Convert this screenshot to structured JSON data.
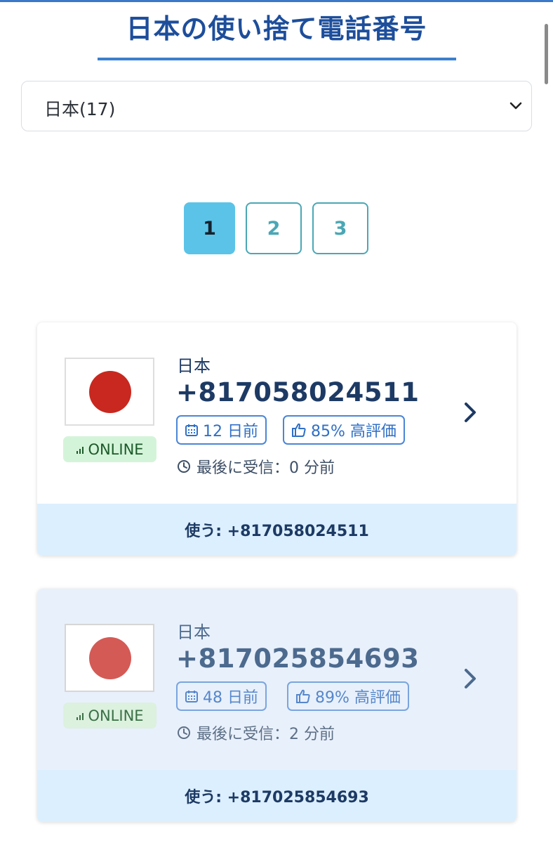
{
  "page": {
    "title": "日本の使い捨て電話番号"
  },
  "country_select": {
    "value": "日本(17)"
  },
  "pagination": {
    "pages": [
      "1",
      "2",
      "3"
    ],
    "active": "1"
  },
  "cards": [
    {
      "country": "日本",
      "number": "+817058024511",
      "status": "ONLINE",
      "age": "12 日前",
      "rating": "85% 高評価",
      "last_received": "最後に受信：0 分前",
      "use_label": "使う: +817058024511",
      "flag_color": "#c8281f"
    },
    {
      "country": "日本",
      "number": "+817025854693",
      "status": "ONLINE",
      "age": "48 日前",
      "rating": "89% 高評価",
      "last_received": "最後に受信：2 分前",
      "use_label": "使う: +817025854693",
      "flag_color": "#d45a56"
    }
  ],
  "colors": {
    "accent": "#1d4e9b",
    "page_active": "#5bc3e8",
    "online_bg": "#d4f4d9",
    "footer_bg": "#dcefff"
  }
}
